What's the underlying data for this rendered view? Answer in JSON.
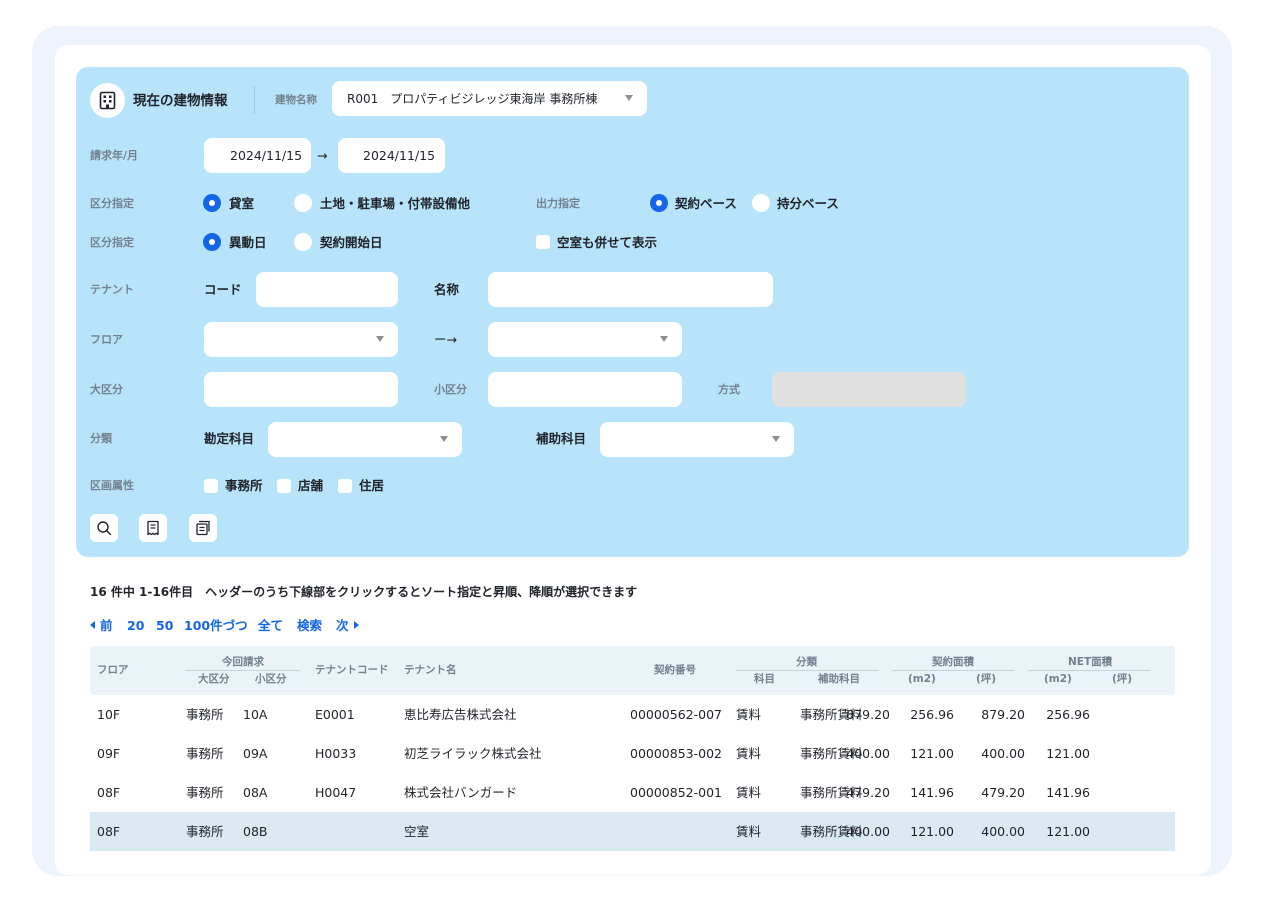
{
  "header": {
    "title": "現在の建物情報",
    "building_label": "建物名称",
    "building_value": "R001　プロパティビジレッジ東海岸 事務所棟"
  },
  "form": {
    "billing_label": "請求年/月",
    "date_from": "2024/11/15",
    "arrow": "→",
    "date_to": "2024/11/15",
    "category_label": "区分指定",
    "category_options": [
      "貸室",
      "土地・駐車場・付帯設備他"
    ],
    "output_label": "出力指定",
    "output_options": [
      "契約ベース",
      "持分ベース"
    ],
    "category2_label": "区分指定",
    "category2_options": [
      "異動日",
      "契約開始日"
    ],
    "vacant_label": "空室も併せて表示",
    "tenant_label": "テナント",
    "code_label": "コード",
    "name_label": "名称",
    "floor_label": "フロア",
    "floor_arrow": "ー→",
    "large_label": "大区分",
    "small_label": "小区分",
    "method_label": "方式",
    "class_label": "分類",
    "account_label": "勘定科目",
    "subaccount_label": "補助科目",
    "attr_label": "区画属性",
    "attr_options": [
      "事務所",
      "店舗",
      "住居"
    ]
  },
  "results": {
    "summary": "16 件中 1-16件目　ヘッダーのうち下線部をクリックするとソート指定と昇順、降順が選択できます",
    "pager": {
      "prev": "前",
      "p20": "20",
      "p50": "50",
      "p100": "100件づつ",
      "all": "全て",
      "search": "検索",
      "next": "次"
    }
  },
  "table": {
    "h_floor": "フロア",
    "h_billing": "今回請求",
    "h_large": "大区分",
    "h_small": "小区分",
    "h_tcode": "テナントコード",
    "h_tname": "テナント名",
    "h_contract": "契約番号",
    "h_class": "分類",
    "h_item": "科目",
    "h_sub": "補助科目",
    "h_carea": "契約面積",
    "h_narea": "NET面積",
    "h_m2": "(m2)",
    "h_tsubo": "(坪)",
    "rows": [
      {
        "floor": "10F",
        "large": "事務所",
        "small": "10A",
        "code": "E0001",
        "name": "恵比寿広告株式会社",
        "contract": "00000562-007",
        "item": "賃料",
        "sub": "事務所賃料",
        "cm2": "879.20",
        "ctsubo": "256.96",
        "nm2": "879.20",
        "ntsubo": "256.96"
      },
      {
        "floor": "09F",
        "large": "事務所",
        "small": "09A",
        "code": "H0033",
        "name": "初芝ライラック株式会社",
        "contract": "00000853-002",
        "item": "賃料",
        "sub": "事務所賃料",
        "cm2": "400.00",
        "ctsubo": "121.00",
        "nm2": "400.00",
        "ntsubo": "121.00"
      },
      {
        "floor": "08F",
        "large": "事務所",
        "small": "08A",
        "code": "H0047",
        "name": "株式会社バンガード",
        "contract": "00000852-001",
        "item": "賃料",
        "sub": "事務所賃料",
        "cm2": "479.20",
        "ctsubo": "141.96",
        "nm2": "479.20",
        "ntsubo": "141.96"
      },
      {
        "floor": "08F",
        "large": "事務所",
        "small": "08B",
        "code": "",
        "name": "空室",
        "contract": "",
        "item": "賃料",
        "sub": "事務所賃料",
        "cm2": "400.00",
        "ctsubo": "121.00",
        "nm2": "400.00",
        "ntsubo": "121.00"
      }
    ]
  }
}
